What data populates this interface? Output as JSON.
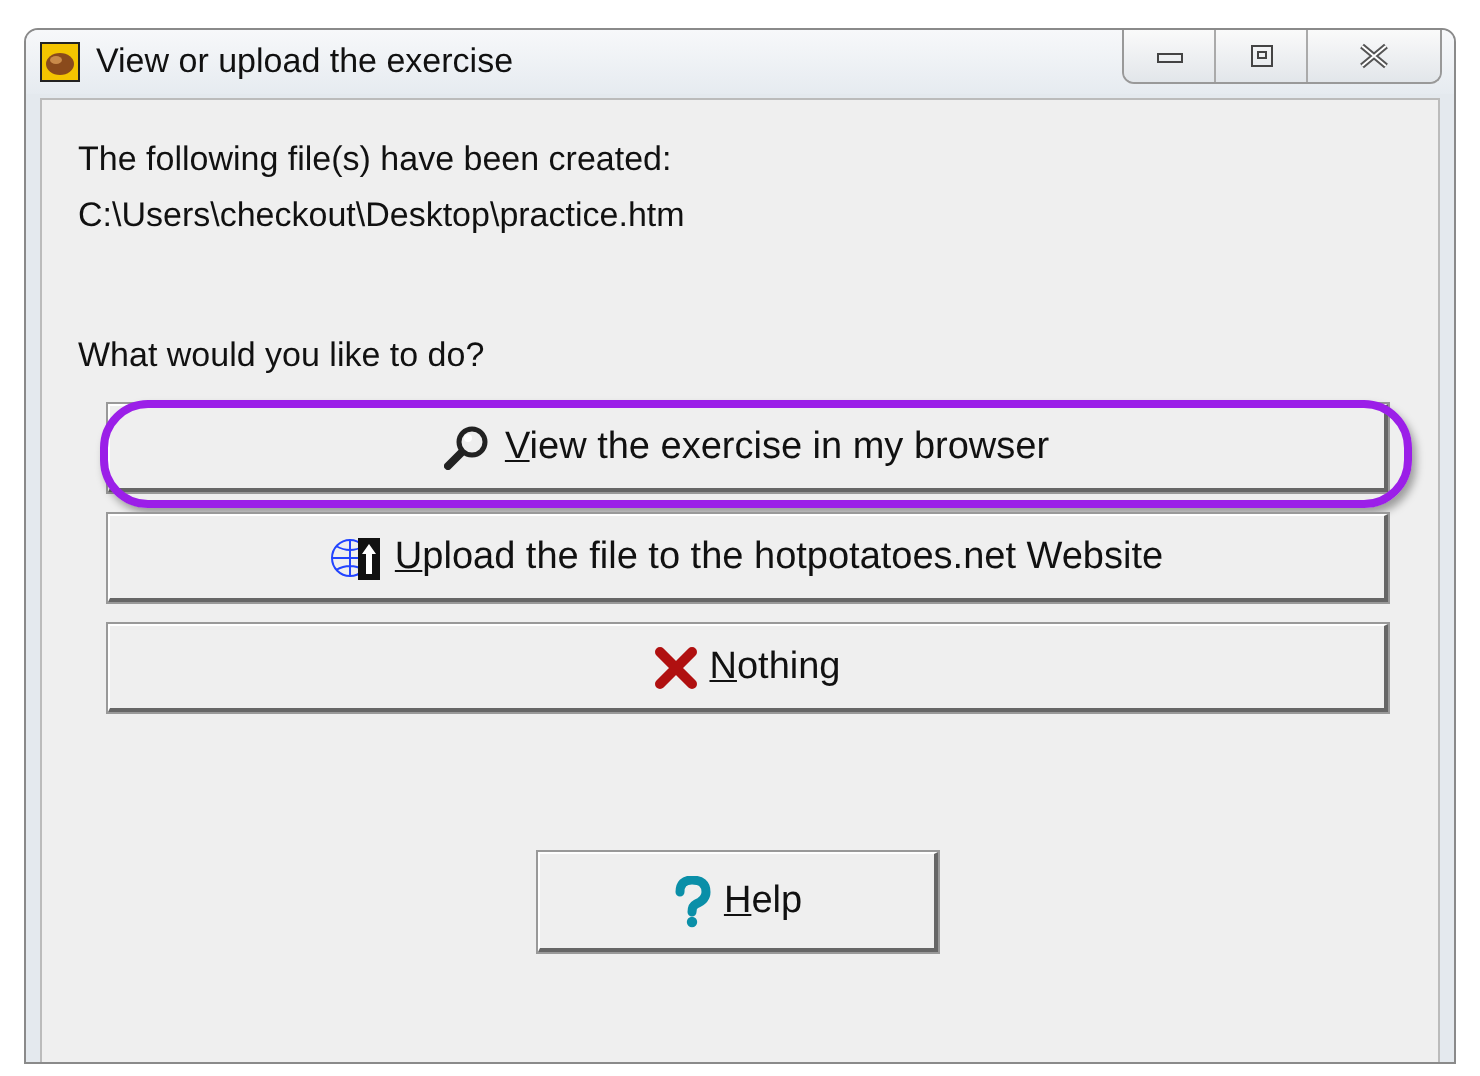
{
  "window": {
    "title": "View or upload the exercise"
  },
  "message": [
    "The following file(s) have been created:",
    "C:\\Users\\checkout\\Desktop\\practice.htm"
  ],
  "question": "What would you like to do?",
  "actions": [
    {
      "kind": "view",
      "label": "View the exercise in my browser",
      "highlighted": true
    },
    {
      "kind": "upload",
      "label": "Upload the file to the hotpotatoes.net Website",
      "highlighted": false
    },
    {
      "kind": "nothing",
      "label": "Nothing",
      "highlighted": false
    }
  ],
  "help": {
    "label": "Help"
  }
}
